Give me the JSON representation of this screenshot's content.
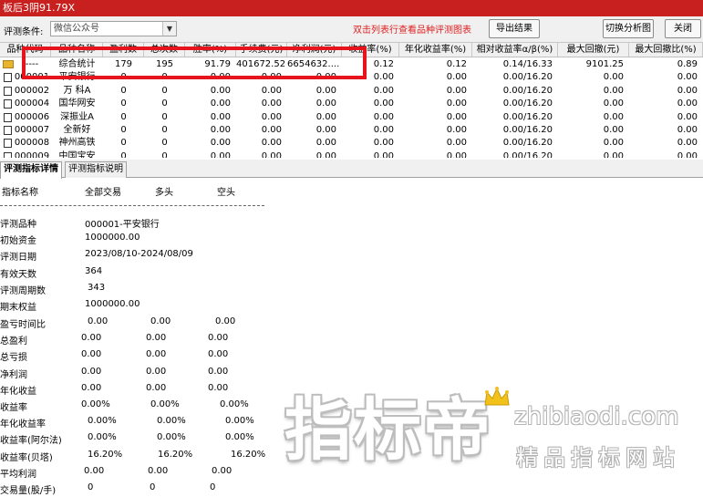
{
  "window": {
    "title": "板后3阴91.79X"
  },
  "toolbar": {
    "label": "评测条件:",
    "select_value": "微信公众号",
    "hint": "双击列表行查看品种评测图表",
    "export_label": "导出结果",
    "switch_label": "切换分析图",
    "close_label": "关闭"
  },
  "grid": {
    "headers": [
      "品种代码",
      "品种名称",
      "盈利数",
      "总次数",
      "胜率(%)",
      "手续费(元)",
      "净利润(元)",
      "收益率(%)",
      "年化收益率(%)",
      "相对收益率α/β(%)",
      "最大回撤(元)",
      "最大回撤比(%)"
    ],
    "rows": [
      [
        "----",
        "综合统计",
        "179",
        "195",
        "91.79",
        "401672.52",
        "6654632....",
        "0.12",
        "0.12",
        "0.14/16.33",
        "9101.25",
        "0.89"
      ],
      [
        "000001",
        "平安银行",
        "0",
        "0",
        "0.00",
        "0.00",
        "0.00",
        "0.00",
        "0.00",
        "0.00/16.20",
        "0.00",
        "0.00"
      ],
      [
        "000002",
        "万 科A",
        "0",
        "0",
        "0.00",
        "0.00",
        "0.00",
        "0.00",
        "0.00",
        "0.00/16.20",
        "0.00",
        "0.00"
      ],
      [
        "000004",
        "国华网安",
        "0",
        "0",
        "0.00",
        "0.00",
        "0.00",
        "0.00",
        "0.00",
        "0.00/16.20",
        "0.00",
        "0.00"
      ],
      [
        "000006",
        "深振业A",
        "0",
        "0",
        "0.00",
        "0.00",
        "0.00",
        "0.00",
        "0.00",
        "0.00/16.20",
        "0.00",
        "0.00"
      ],
      [
        "000007",
        "全新好",
        "0",
        "0",
        "0.00",
        "0.00",
        "0.00",
        "0.00",
        "0.00",
        "0.00/16.20",
        "0.00",
        "0.00"
      ],
      [
        "000008",
        "神州高铁",
        "0",
        "0",
        "0.00",
        "0.00",
        "0.00",
        "0.00",
        "0.00",
        "0.00/16.20",
        "0.00",
        "0.00"
      ],
      [
        "000009",
        "中国宝安",
        "0",
        "0",
        "0.00",
        "0.00",
        "0.00",
        "0.00",
        "0.00",
        "0.00/16.20",
        "0.00",
        "0.00"
      ]
    ]
  },
  "tabs": [
    "评测指标详情",
    "评测指标说明"
  ],
  "details": {
    "header": [
      "指标名称",
      "全部交易",
      "多头",
      "空头"
    ],
    "separator": "------------------------------------------------------------------------------",
    "info": [
      [
        "评测品种",
        "000001-平安银行"
      ],
      [
        "初始资金",
        "1000000.00"
      ],
      [
        "评测日期",
        "2023/08/10-2024/08/09"
      ],
      [
        "有效天数",
        "364"
      ],
      [
        "评测周期数",
        "343"
      ],
      [
        "期末权益",
        "1000000.00"
      ]
    ],
    "metrics": [
      [
        "盈亏时间比",
        "0.00",
        "0.00",
        "0.00"
      ],
      [
        "总盈利",
        "0.00",
        "0.00",
        "0.00"
      ],
      [
        "总亏损",
        "0.00",
        "0.00",
        "0.00"
      ],
      [
        "净利润",
        "0.00",
        "0.00",
        "0.00"
      ],
      [
        "年化收益",
        "0.00",
        "0.00",
        "0.00"
      ],
      [
        "收益率",
        "0.00%",
        "0.00%",
        "0.00%"
      ],
      [
        "年化收益率",
        "0.00%",
        "0.00%",
        "0.00%"
      ],
      [
        "收益率(阿尔法)",
        "0.00%",
        "0.00%",
        "0.00%"
      ],
      [
        "收益率(贝塔)",
        "16.20%",
        "16.20%",
        "16.20%"
      ],
      [
        "平均利润",
        "0.00",
        "0.00",
        "0.00"
      ],
      [
        "交易量(股/手)",
        "0",
        "0",
        "0"
      ]
    ]
  },
  "watermark": {
    "brand": "指标帝",
    "site": "zhibiaodi.com",
    "tagline": "精品指标网站"
  },
  "colors": {
    "titlebar": "#c7201e",
    "hint": "#e02020",
    "annotation": "#e8141b"
  }
}
